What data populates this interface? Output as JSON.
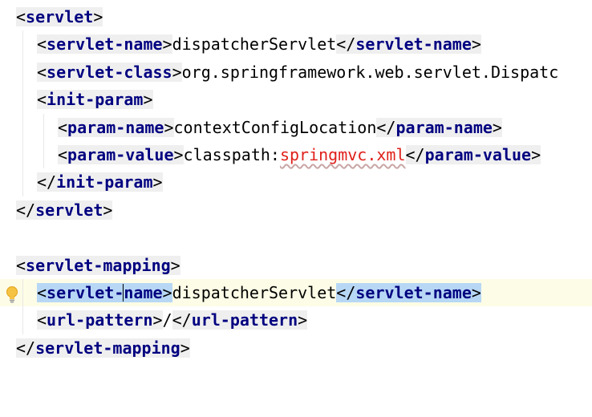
{
  "lines": [
    {
      "parts": [
        "<",
        "servlet",
        ">"
      ]
    },
    {
      "parts": [
        "<",
        "servlet-name",
        ">",
        "dispatcherServlet",
        "</",
        "servlet-name",
        ">"
      ]
    },
    {
      "parts": [
        "<",
        "servlet-class",
        ">",
        "org.springframework.web.servlet.Dispatc"
      ]
    },
    {
      "parts": [
        "<",
        "init-param",
        ">"
      ]
    },
    {
      "parts": [
        "<",
        "param-name",
        ">",
        "contextConfigLocation",
        "</",
        "param-name",
        ">"
      ]
    },
    {
      "parts": [
        "<",
        "param-value",
        ">",
        "classpath:",
        "springmvc.xml",
        "</",
        "param-value",
        ">"
      ]
    },
    {
      "parts": [
        "</",
        "init-param",
        ">"
      ]
    },
    {
      "parts": [
        "</",
        "servlet",
        ">"
      ]
    },
    {
      "parts": []
    },
    {
      "parts": [
        "<",
        "servlet-mapping",
        ">"
      ]
    },
    {
      "parts": [
        "<",
        "servlet-",
        "name",
        ">",
        "dispatcherServlet",
        "</",
        "servlet-name",
        ">"
      ]
    },
    {
      "parts": [
        "<",
        "url-pattern",
        ">",
        "/",
        "</",
        "url-pattern",
        ">"
      ]
    },
    {
      "parts": [
        "</",
        "servlet-mapping",
        ">"
      ]
    }
  ],
  "icons": {
    "gutter": "lightbulb-icon"
  },
  "colors": {
    "tag": "#000080",
    "tag_background": "#efefef",
    "error_text": "#e0201a",
    "match_highlight": "#b7d7f5",
    "current_line": "#fdfce6"
  }
}
